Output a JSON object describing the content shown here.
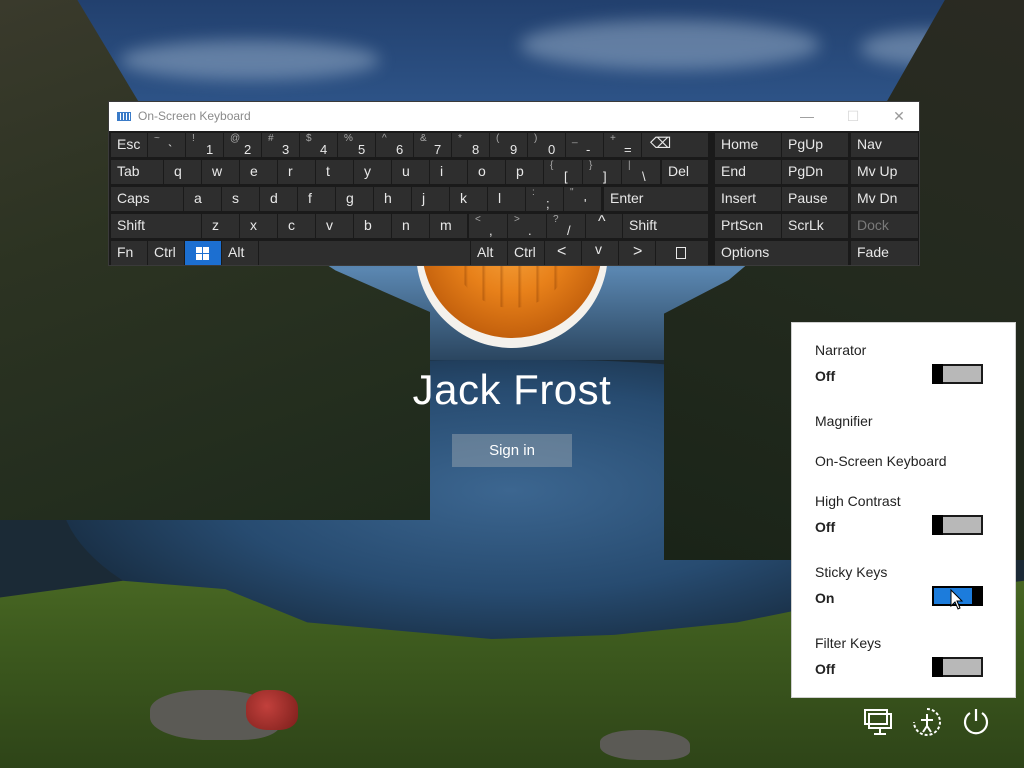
{
  "login": {
    "username": "Jack Frost",
    "sign_in_label": "Sign in"
  },
  "osk": {
    "title": "On-Screen Keyboard",
    "minimize": "—",
    "maximize": "☐",
    "close": "✕",
    "row1": {
      "esc": "Esc",
      "keys": [
        {
          "shift": "~",
          "main": "`"
        },
        {
          "shift": "!",
          "main": "1"
        },
        {
          "shift": "@",
          "main": "2"
        },
        {
          "shift": "#",
          "main": "3"
        },
        {
          "shift": "$",
          "main": "4"
        },
        {
          "shift": "%",
          "main": "5"
        },
        {
          "shift": "^",
          "main": "6"
        },
        {
          "shift": "&",
          "main": "7"
        },
        {
          "shift": "*",
          "main": "8"
        },
        {
          "shift": "(",
          "main": "9"
        },
        {
          "shift": ")",
          "main": "0"
        },
        {
          "shift": "_",
          "main": "-"
        },
        {
          "shift": "+",
          "main": "="
        }
      ],
      "backspace_icon": "⌫"
    },
    "row2": {
      "tab": "Tab",
      "letters": [
        "q",
        "w",
        "e",
        "r",
        "t",
        "y",
        "u",
        "i",
        "o",
        "p"
      ],
      "brackets": [
        {
          "shift": "{",
          "main": "["
        },
        {
          "shift": "}",
          "main": "]"
        },
        {
          "shift": "|",
          "main": "\\"
        }
      ],
      "del": "Del"
    },
    "row3": {
      "caps": "Caps",
      "letters": [
        "a",
        "s",
        "d",
        "f",
        "g",
        "h",
        "j",
        "k",
        "l"
      ],
      "punct": [
        {
          "shift": ":",
          "main": ";"
        },
        {
          "shift": "\"",
          "main": "'"
        }
      ],
      "enter": "Enter"
    },
    "row4": {
      "shift": "Shift",
      "letters": [
        "z",
        "x",
        "c",
        "v",
        "b",
        "n",
        "m"
      ],
      "punct": [
        {
          "shift": "<",
          "main": ","
        },
        {
          "shift": ">",
          "main": "."
        },
        {
          "shift": "?",
          "main": "/"
        }
      ],
      "up": "^",
      "shift_right": "Shift"
    },
    "row5": {
      "fn": "Fn",
      "ctrl": "Ctrl",
      "alt": "Alt",
      "alt_right": "Alt",
      "ctrl_right": "Ctrl",
      "left": "<",
      "down": "v",
      "right": ">"
    },
    "nav": {
      "home": "Home",
      "pgup": "PgUp",
      "nav": "Nav",
      "end": "End",
      "pgdn": "PgDn",
      "mvup": "Mv Up",
      "insert": "Insert",
      "pause": "Pause",
      "mvdn": "Mv Dn",
      "prtscn": "PrtScn",
      "scrlk": "ScrLk",
      "dock": "Dock",
      "options": "Options",
      "fade": "Fade"
    },
    "colors": {
      "key_bg": "#2e2e2e",
      "window_bg": "#1a1a1a",
      "active_blue": "#1c6fd1"
    }
  },
  "ease_of_access": {
    "narrator": {
      "label": "Narrator",
      "state": "Off"
    },
    "magnifier": {
      "label": "Magnifier"
    },
    "osk": {
      "label": "On-Screen Keyboard"
    },
    "high_contrast": {
      "label": "High Contrast",
      "state": "Off"
    },
    "sticky_keys": {
      "label": "Sticky Keys",
      "state": "On"
    },
    "filter_keys": {
      "label": "Filter Keys",
      "state": "Off"
    },
    "toggle_on_color": "#1c7cdc"
  },
  "system_icons": [
    "network-icon",
    "ease-of-access-icon",
    "power-icon"
  ]
}
